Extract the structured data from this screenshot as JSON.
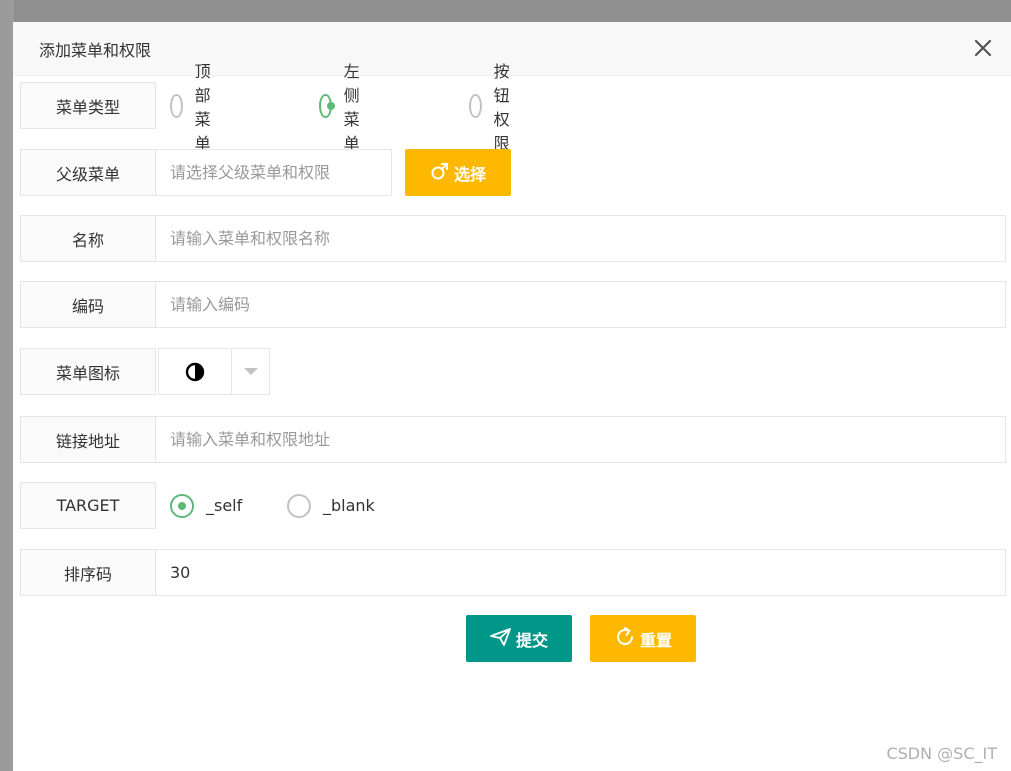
{
  "dialog": {
    "title": "添加菜单和权限",
    "close_symbol": "×"
  },
  "fields": {
    "menu_type": {
      "label": "菜单类型",
      "options": [
        "顶部菜单",
        "左侧菜单",
        "按钮权限"
      ],
      "selected": "左侧菜单"
    },
    "parent_menu": {
      "label": "父级菜单",
      "placeholder": "请选择父级菜单和权限",
      "value": "",
      "select_button": "选择",
      "select_icon": "male-symbol-icon"
    },
    "name": {
      "label": "名称",
      "placeholder": "请输入菜单和权限名称",
      "value": ""
    },
    "code": {
      "label": "编码",
      "placeholder": "请输入编码",
      "value": ""
    },
    "menu_icon": {
      "label": "菜单图标",
      "selected_icon": "half-circle-icon"
    },
    "link": {
      "label": "链接地址",
      "placeholder": "请输入菜单和权限地址",
      "value": ""
    },
    "target": {
      "label": "TARGET",
      "options": [
        "_self",
        "_blank"
      ],
      "selected": "_self"
    },
    "sort": {
      "label": "排序码",
      "value": "30"
    }
  },
  "actions": {
    "submit_label": "提交",
    "submit_icon": "paper-plane-icon",
    "reset_label": "重置",
    "reset_icon": "refresh-icon"
  },
  "colors": {
    "warm": "#ffb800",
    "primary": "#009688",
    "radio_checked": "#5fb878"
  },
  "watermark": "CSDN @SC_IT"
}
